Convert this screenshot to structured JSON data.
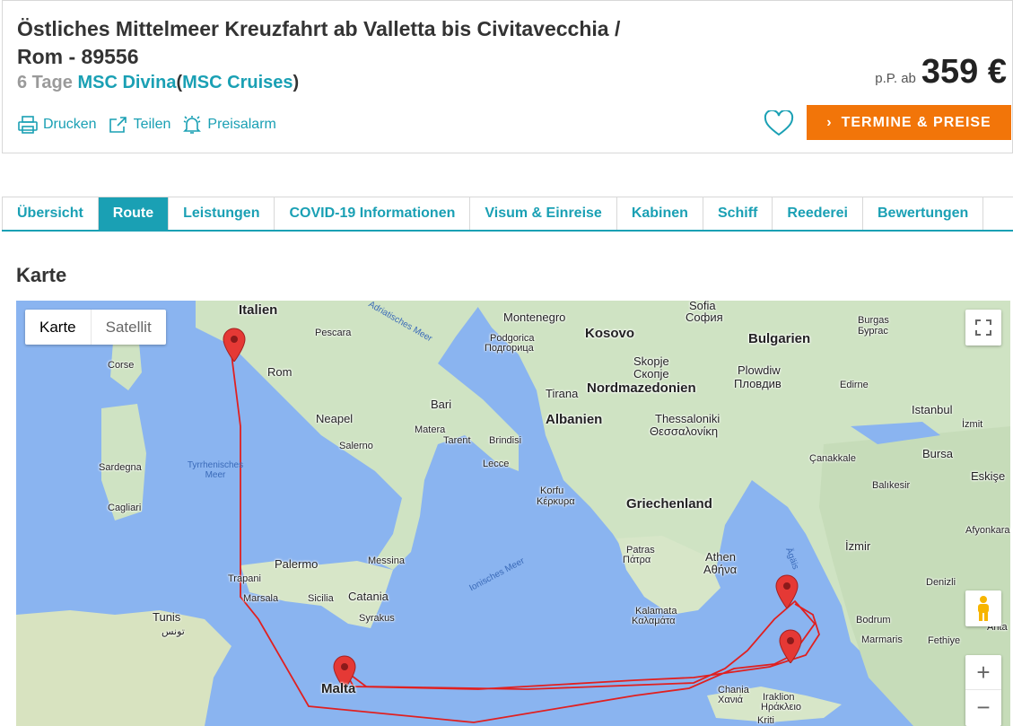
{
  "header": {
    "title": "Östliches Mittelmeer Kreuzfahrt ab Valletta bis Civitavecchia / Rom - 89556",
    "days": "6 Tage",
    "ship": "MSC Divina",
    "paren_open": "(",
    "line": "MSC Cruises",
    "paren_close": ")",
    "price_prefix": "p.P. ab",
    "price": "359 €",
    "cta": "TERMINE & PREISE",
    "actions": [
      {
        "label": "Drucken",
        "icon": "printer-icon"
      },
      {
        "label": "Teilen",
        "icon": "share-icon"
      },
      {
        "label": "Preisalarm",
        "icon": "bell-icon"
      }
    ]
  },
  "tabs": [
    {
      "label": "Übersicht",
      "active": false
    },
    {
      "label": "Route",
      "active": true
    },
    {
      "label": "Leistungen",
      "active": false
    },
    {
      "label": "COVID-19 Informationen",
      "active": false
    },
    {
      "label": "Visum & Einreise",
      "active": false
    },
    {
      "label": "Kabinen",
      "active": false
    },
    {
      "label": "Schiff",
      "active": false
    },
    {
      "label": "Reederei",
      "active": false
    },
    {
      "label": "Bewertungen",
      "active": false
    }
  ],
  "section": {
    "title": "Karte"
  },
  "map": {
    "type_options": [
      "Karte",
      "Satellit"
    ],
    "selected_type": "Karte",
    "zoom_in": "+",
    "zoom_out": "−",
    "colors": {
      "sea": "#8ab4f0",
      "land": "#cfe3c3",
      "route": "#e02020",
      "marker": "#e53935"
    },
    "labels": {
      "italien": "Italien",
      "rom": "Rom",
      "pescara": "Pescara",
      "corse": "Corse",
      "neapel": "Neapel",
      "bari": "Bari",
      "matera": "Matera",
      "tarent": "Tarent",
      "brindisi": "Brindisi",
      "salerno": "Salerno",
      "lecce": "Lecce",
      "sardegna": "Sardegna",
      "cagliari": "Cagliari",
      "tyrrhenisches": "Tyrrhenisches Meer",
      "adriatisches": "Adriatisches Meer",
      "ionisches": "Ionisches Meer",
      "palermo": "Palermo",
      "messina": "Messina",
      "trapani": "Trapani",
      "marsala": "Marsala",
      "sicilia": "Sicilia",
      "catania": "Catania",
      "syrakus": "Syrakus",
      "tunis": "Tunis",
      "tunis_ar": "تونس",
      "malta": "Malta",
      "montenegro": "Montenegro",
      "podgorica": "Podgorica",
      "podgorica_cyr": "Подгорица",
      "kosovo": "Kosovo",
      "sofia": "Sofia",
      "sofia_cyr": "София",
      "bulgarien": "Bulgarien",
      "burgas": "Burgas",
      "burgas_cyr": "Бургас",
      "skopje": "Skopje",
      "skopje_cyr": "Скопје",
      "plowdiw": "Plowdiw",
      "plowdiw_cyr": "Пловдив",
      "tirana": "Tirana",
      "nordmazedonien": "Nordmazedonien",
      "albanien": "Albanien",
      "edirne": "Edirne",
      "istanbul": "Istanbul",
      "izmit": "İzmit",
      "thessaloniki": "Thessaloniki",
      "thessaloniki_gr": "Θεσσαλονίκη",
      "canakkale": "Çanakkale",
      "bursa": "Bursa",
      "eskise": "Eskişe",
      "balikesir": "Balıkesir",
      "korfu": "Korfu",
      "korfu_gr": "Κέρκυρα",
      "griechenland": "Griechenland",
      "afyonkara": "Afyonkara",
      "izmir": "İzmir",
      "patras": "Patras",
      "patras_gr": "Πάτρα",
      "athen": "Athen",
      "athen_gr": "Αθήνα",
      "aegais": "Ägäis",
      "denizli": "Denizli",
      "kalamata": "Kalamata",
      "kalamata_gr": "Καλαμάτα",
      "bodrum": "Bodrum",
      "marmaris": "Marmaris",
      "fethiye": "Fethiye",
      "anta": "Anta",
      "chania": "Chania",
      "chania_gr": "Χανιά",
      "iraklion": "Iraklion",
      "iraklion_gr": "Ηράκλειο",
      "kriti": "Kriti"
    }
  }
}
